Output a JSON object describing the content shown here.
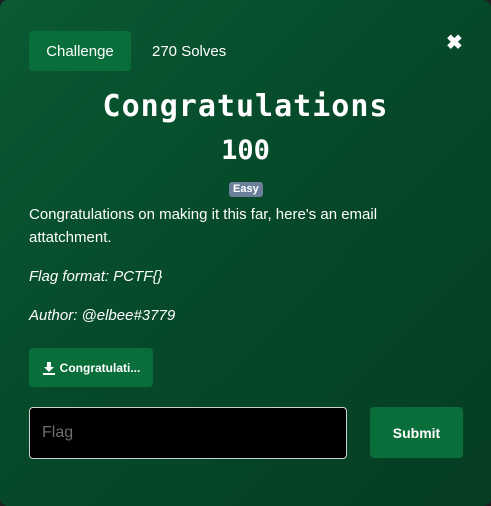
{
  "header": {
    "tab_label": "Challenge",
    "solves_text": "270 Solves",
    "close_glyph": "✖"
  },
  "challenge": {
    "title": "Congratulations",
    "points": "100",
    "difficulty": "Easy",
    "description": "Congratulations on making it this far, here's an email attatchment.",
    "flag_format": "Flag format: PCTF{}",
    "author": "Author: @elbee#3779"
  },
  "file": {
    "label": "Congratulati...",
    "icon": "download-icon"
  },
  "form": {
    "flag_placeholder": "Flag",
    "flag_value": "",
    "submit_label": "Submit"
  },
  "colors": {
    "modal_bg": "#064a2a",
    "button_bg": "#0a6e3a",
    "badge_bg": "#6a7f99"
  }
}
